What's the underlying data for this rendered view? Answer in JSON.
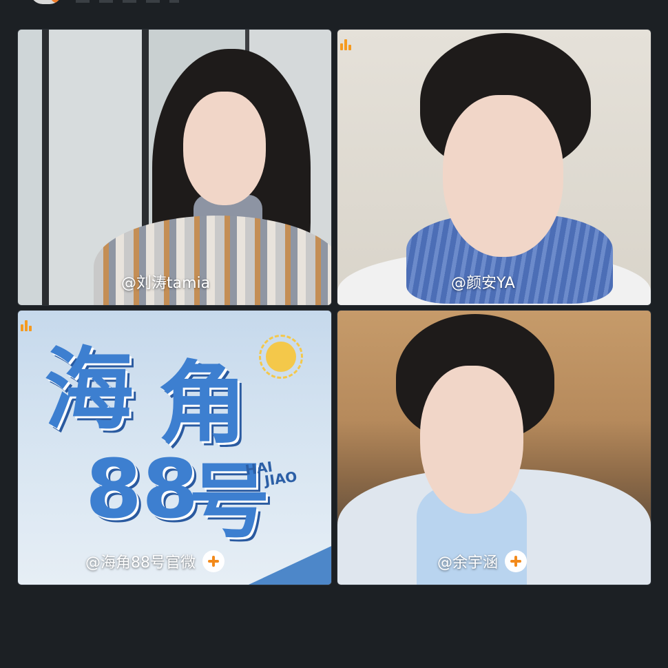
{
  "participants": [
    {
      "name": "@刘涛tamia",
      "speaking_icon": false,
      "follow_button": false
    },
    {
      "name": "@颜安YA",
      "speaking_icon": true,
      "follow_button": false
    },
    {
      "name": "@海角88号官微",
      "speaking_icon": true,
      "follow_button": true
    },
    {
      "name": "@余宇涵",
      "speaking_icon": false,
      "follow_button": true
    }
  ],
  "poster": {
    "chars": [
      "海",
      "角",
      "88",
      "号"
    ],
    "latin_top": "HAI",
    "latin_bottom": "JIAO"
  },
  "icons": {
    "speaking": "audio-level-icon",
    "follow": "plus-circle-icon"
  },
  "colors": {
    "background": "#1c2024",
    "accent": "#f28a1b",
    "poster_blue": "#3d7fd0"
  }
}
